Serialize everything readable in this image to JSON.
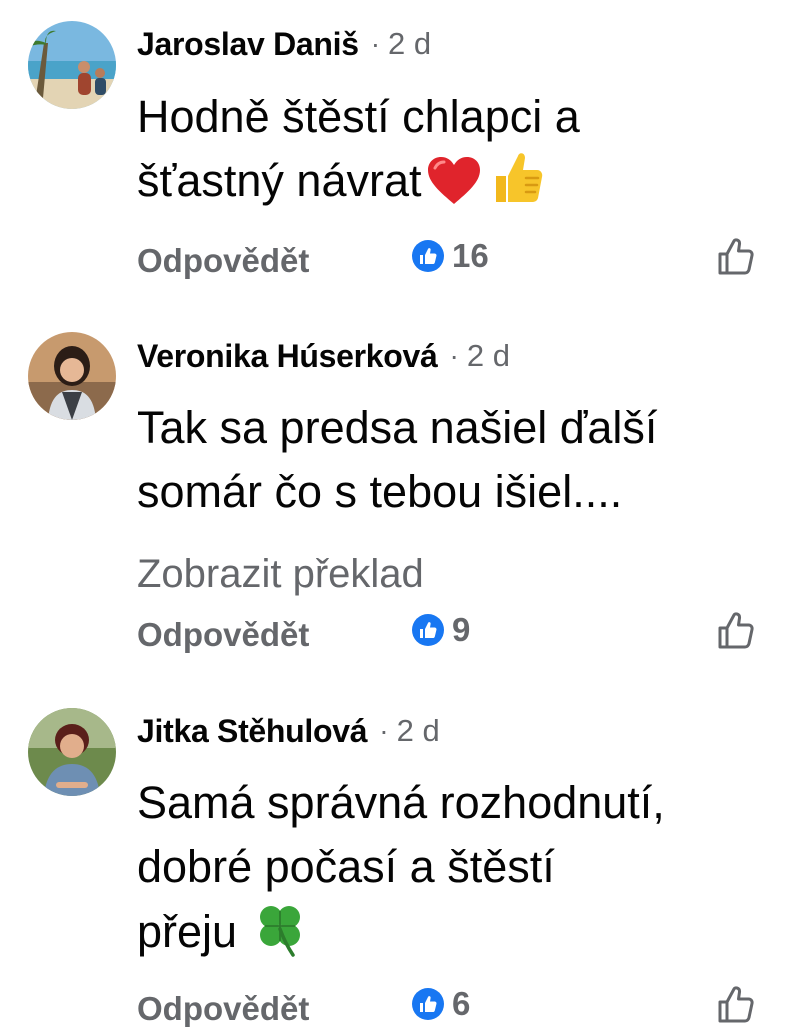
{
  "comments": [
    {
      "author": "Jaroslav Daniš",
      "separator": "·",
      "time": "2 d",
      "text_lines": [
        "Hodně štěstí chlapci a",
        "šťastný návrat"
      ],
      "emojis": [
        "red-heart-icon",
        "thumbs-up-icon"
      ],
      "reply_label": "Odpovědět",
      "reaction_count": "16"
    },
    {
      "author": "Veronika Húserková",
      "separator": "·",
      "time": "2 d",
      "text_lines": [
        "Tak sa predsa našiel ďalší",
        "somár čo s tebou išiel...."
      ],
      "translate_label": "Zobrazit překlad",
      "reply_label": "Odpovědět",
      "reaction_count": "9"
    },
    {
      "author": "Jitka Stěhulová",
      "separator": "·",
      "time": "2 d",
      "text_lines": [
        "Samá správná rozhodnutí,",
        "dobré počasí a štěstí",
        "přeju"
      ],
      "emojis": [
        "four-leaf-clover-icon"
      ],
      "reply_label": "Odpovědět",
      "reaction_count": "6"
    }
  ],
  "colors": {
    "text": "#050505",
    "secondary": "#65676b",
    "like_blue": "#1877f2"
  }
}
